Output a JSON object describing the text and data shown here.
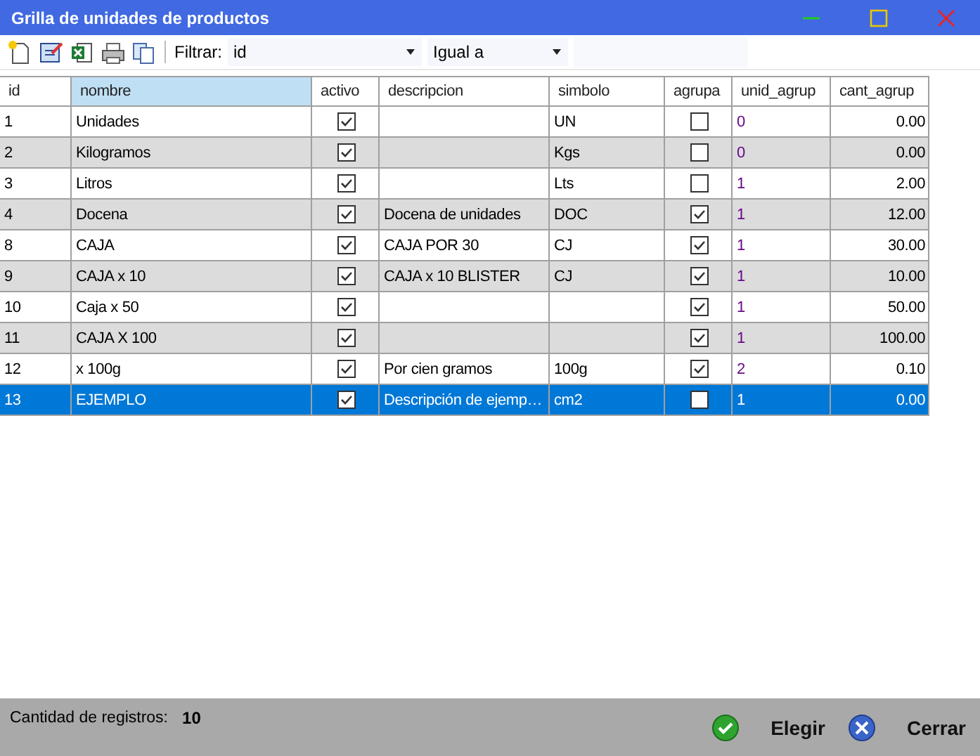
{
  "window": {
    "title": "Grilla de unidades de productos"
  },
  "toolbar": {
    "filter_label": "Filtrar:",
    "filter_field": "id",
    "operator": "Igual a"
  },
  "table": {
    "columns": [
      {
        "label": "id",
        "selected": false,
        "kind": "text"
      },
      {
        "label": "nombre",
        "selected": true,
        "kind": "text"
      },
      {
        "label": "activo",
        "selected": false,
        "kind": "check"
      },
      {
        "label": "descripcion",
        "selected": false,
        "kind": "text"
      },
      {
        "label": "simbolo",
        "selected": false,
        "kind": "text"
      },
      {
        "label": "agrupa",
        "selected": false,
        "kind": "check"
      },
      {
        "label": "unid_agrup",
        "selected": false,
        "kind": "link"
      },
      {
        "label": "cant_agrup",
        "selected": false,
        "kind": "number"
      }
    ],
    "rows": [
      {
        "selected": false,
        "cells": [
          "1",
          "Unidades",
          true,
          "",
          "UN",
          false,
          "0",
          "0.00"
        ]
      },
      {
        "selected": false,
        "cells": [
          "2",
          "Kilogramos",
          true,
          "",
          "Kgs",
          false,
          "0",
          "0.00"
        ]
      },
      {
        "selected": false,
        "cells": [
          "3",
          "Litros",
          true,
          "",
          "Lts",
          false,
          "1",
          "2.00"
        ]
      },
      {
        "selected": false,
        "cells": [
          "4",
          "Docena",
          true,
          "Docena de unidades",
          "DOC",
          true,
          "1",
          "12.00"
        ]
      },
      {
        "selected": false,
        "cells": [
          "8",
          "CAJA",
          true,
          "CAJA POR 30",
          "CJ",
          true,
          "1",
          "30.00"
        ]
      },
      {
        "selected": false,
        "cells": [
          "9",
          "CAJA x 10",
          true,
          "CAJA x 10 BLISTER",
          "CJ",
          true,
          "1",
          "10.00"
        ]
      },
      {
        "selected": false,
        "cells": [
          "10",
          "Caja x 50",
          true,
          "",
          "",
          true,
          "1",
          "50.00"
        ]
      },
      {
        "selected": false,
        "cells": [
          "11",
          "CAJA X 100",
          true,
          "",
          "",
          true,
          "1",
          "100.00"
        ]
      },
      {
        "selected": false,
        "cells": [
          "12",
          "x 100g",
          true,
          "Por cien gramos",
          "100g",
          true,
          "2",
          "0.10"
        ]
      },
      {
        "selected": true,
        "cells": [
          "13",
          "EJEMPLO",
          true,
          "Descripción de ejemp…",
          "cm2",
          false,
          "1",
          "0.00"
        ]
      }
    ]
  },
  "footer": {
    "count_label": "Cantidad de registros:",
    "count": "10",
    "buttons": [
      {
        "label": "Elegir",
        "kind": "ok"
      },
      {
        "label": "Cerrar",
        "kind": "close"
      }
    ]
  }
}
